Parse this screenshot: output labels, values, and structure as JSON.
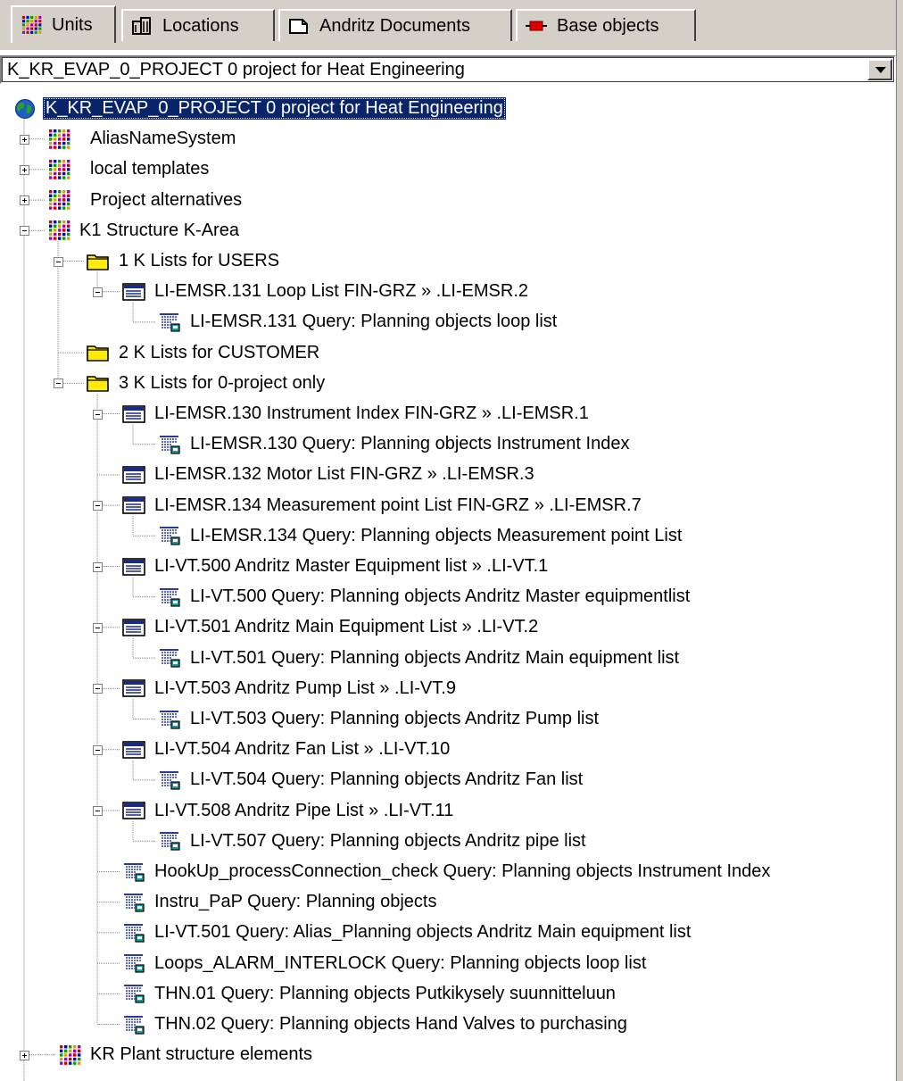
{
  "tabs": [
    {
      "label": "Units",
      "icon": "dots-grid-icon",
      "active": true
    },
    {
      "label": "Locations",
      "icon": "building-icon",
      "active": false
    },
    {
      "label": "Andritz Documents",
      "icon": "document-icon",
      "active": false
    },
    {
      "label": "Base objects",
      "icon": "red-block-icon",
      "active": false
    }
  ],
  "combo": {
    "value": "K_KR_EVAP_0_PROJECT   0 project for Heat Engineering"
  },
  "tree": [
    {
      "level": 0,
      "icon": "globe-icon",
      "label": "K_KR_EVAP_0_PROJECT   0 project for Heat Engineering",
      "selected": true
    },
    {
      "level": 1,
      "icon": "dots-grid-icon",
      "label": "AliasNameSystem",
      "toggle": "plus",
      "gap": true
    },
    {
      "level": 1,
      "icon": "dots-grid-icon",
      "label": "local templates",
      "toggle": "plus",
      "gap": true
    },
    {
      "level": 1,
      "icon": "dots-grid-icon",
      "label": "Project alternatives",
      "toggle": "plus",
      "gap": true
    },
    {
      "level": 1,
      "icon": "dots-grid-icon",
      "label": "K1   Structure K-Area",
      "toggle": "minus"
    },
    {
      "level": 2,
      "icon": "folder-icon",
      "label": "1   K Lists for USERS",
      "toggle": "minus"
    },
    {
      "level": 3,
      "icon": "list-doc-icon",
      "label": "LI-EMSR.131  Loop List FIN-GRZ  »  .LI-EMSR.2",
      "toggle": "minus"
    },
    {
      "level": 4,
      "icon": "query-icon",
      "label": "LI-EMSR.131   Query: Planning objects loop list"
    },
    {
      "level": 2,
      "icon": "folder-icon",
      "label": "2   K Lists for CUSTOMER"
    },
    {
      "level": 2,
      "icon": "folder-icon",
      "label": "3   K Lists for 0-project only",
      "toggle": "minus"
    },
    {
      "level": 3,
      "icon": "list-doc-icon",
      "label": "LI-EMSR.130  Instrument Index FIN-GRZ  »  .LI-EMSR.1",
      "toggle": "minus"
    },
    {
      "level": 4,
      "icon": "query-icon",
      "label": "LI-EMSR.130   Query: Planning objects Instrument Index"
    },
    {
      "level": 3,
      "icon": "list-doc-icon",
      "label": "LI-EMSR.132  Motor List FIN-GRZ  »  .LI-EMSR.3"
    },
    {
      "level": 3,
      "icon": "list-doc-icon",
      "label": "LI-EMSR.134  Measurement point List FIN-GRZ  »  .LI-EMSR.7",
      "toggle": "minus"
    },
    {
      "level": 4,
      "icon": "query-icon",
      "label": "LI-EMSR.134   Query: Planning objects Measurement point List"
    },
    {
      "level": 3,
      "icon": "list-doc-icon",
      "label": "LI-VT.500  Andritz Master Equipment list  »  .LI-VT.1",
      "toggle": "minus"
    },
    {
      "level": 4,
      "icon": "query-icon",
      "label": "LI-VT.500   Query: Planning objects Andritz Master equipmentlist"
    },
    {
      "level": 3,
      "icon": "list-doc-icon",
      "label": "LI-VT.501  Andritz Main Equipment List  »  .LI-VT.2",
      "toggle": "minus"
    },
    {
      "level": 4,
      "icon": "query-icon",
      "label": "LI-VT.501   Query: Planning objects Andritz Main equipment list"
    },
    {
      "level": 3,
      "icon": "list-doc-icon",
      "label": "LI-VT.503  Andritz Pump List  »  .LI-VT.9",
      "toggle": "minus"
    },
    {
      "level": 4,
      "icon": "query-icon",
      "label": "LI-VT.503   Query: Planning objects Andritz Pump list"
    },
    {
      "level": 3,
      "icon": "list-doc-icon",
      "label": "LI-VT.504  Andritz Fan List  »  .LI-VT.10",
      "toggle": "minus"
    },
    {
      "level": 4,
      "icon": "query-icon",
      "label": "LI-VT.504   Query: Planning objects Andritz Fan list"
    },
    {
      "level": 3,
      "icon": "list-doc-icon",
      "label": "LI-VT.508  Andritz Pipe List  »  .LI-VT.11",
      "toggle": "minus"
    },
    {
      "level": 4,
      "icon": "query-icon",
      "label": "LI-VT.507   Query: Planning objects Andritz pipe list"
    },
    {
      "level": 3,
      "icon": "query-icon",
      "label": "HookUp_processConnection_check   Query: Planning objects Instrument Index"
    },
    {
      "level": 3,
      "icon": "query-icon",
      "label": "Instru_PaP   Query: Planning objects"
    },
    {
      "level": 3,
      "icon": "query-icon",
      "label": "LI-VT.501    Query: Alias_Planning objects Andritz Main equipment list"
    },
    {
      "level": 3,
      "icon": "query-icon",
      "label": "Loops_ALARM_INTERLOCK   Query: Planning objects loop list"
    },
    {
      "level": 3,
      "icon": "query-icon",
      "label": "THN.01   Query: Planning objects Putkikysely suunnitteluun"
    },
    {
      "level": 3,
      "icon": "query-icon",
      "label": "THN.02   Query: Planning objects Hand Valves to purchasing"
    },
    {
      "level": 1,
      "icon": "dots-grid-icon",
      "label": "KR   Plant structure elements",
      "toggle": "plus",
      "indentExtra": true
    }
  ]
}
